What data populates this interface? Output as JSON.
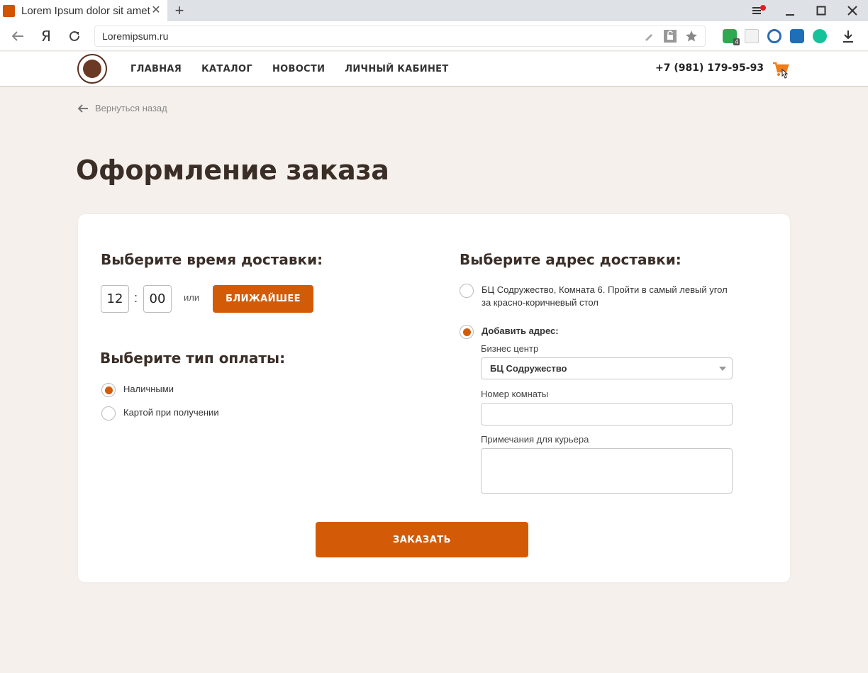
{
  "browser": {
    "tab_title": "Lorem Ipsum dolor sit amet",
    "url": "Loremipsum.ru",
    "extension_badge": "4"
  },
  "header": {
    "nav": [
      "ГЛАВНАЯ",
      "КАТАЛОГ",
      "НОВОСТИ",
      "ЛИЧНЫЙ КАБИНЕТ"
    ],
    "phone": "+7 (981) 179-95-93",
    "accent_color": "#d35b07"
  },
  "page": {
    "back_label": "Вернуться назад",
    "title": "Оформление заказа"
  },
  "delivery_time": {
    "title": "Выберите время доставки:",
    "hours": "12",
    "minutes": "00",
    "or_label": "или",
    "nearest_button": "БЛИЖАЙШЕЕ"
  },
  "payment": {
    "title": "Выберите тип оплаты:",
    "options": [
      {
        "label": "Наличными",
        "selected": true
      },
      {
        "label": "Картой при получении",
        "selected": false
      }
    ]
  },
  "address": {
    "title": "Выберите адрес доставки:",
    "saved_address": "БЦ Содружество, Комната 6. Пройти в самый левый угол за красно-коричневый стол",
    "add_label": "Добавить адрес:",
    "business_center_label": "Бизнес центр",
    "business_center_value": "БЦ Содружество",
    "room_label": "Номер комнаты",
    "room_value": "",
    "notes_label": "Примечания для курьера",
    "notes_value": ""
  },
  "submit_button": "ЗАКАЗАТЬ"
}
